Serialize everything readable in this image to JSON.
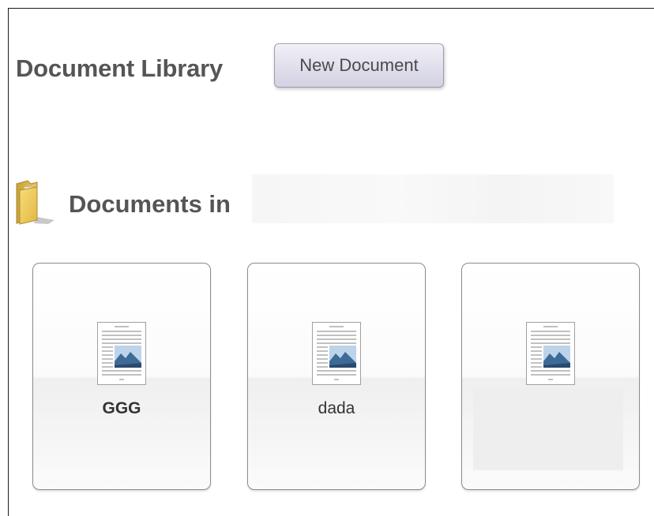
{
  "library": {
    "title": "Document Library",
    "new_button_label": "New Document"
  },
  "section": {
    "title_prefix": "Documents in",
    "folder_name": "",
    "icon": "folder-icon"
  },
  "documents": [
    {
      "name": "GGG",
      "bold": true,
      "icon": "document-thumbnail-icon"
    },
    {
      "name": "dada",
      "bold": false,
      "icon": "document-thumbnail-icon"
    },
    {
      "name": "",
      "bold": false,
      "icon": "document-thumbnail-icon"
    }
  ],
  "colors": {
    "heading": "#555555",
    "button_bg": "#e0dfec",
    "card_border": "#8c8c8c"
  }
}
